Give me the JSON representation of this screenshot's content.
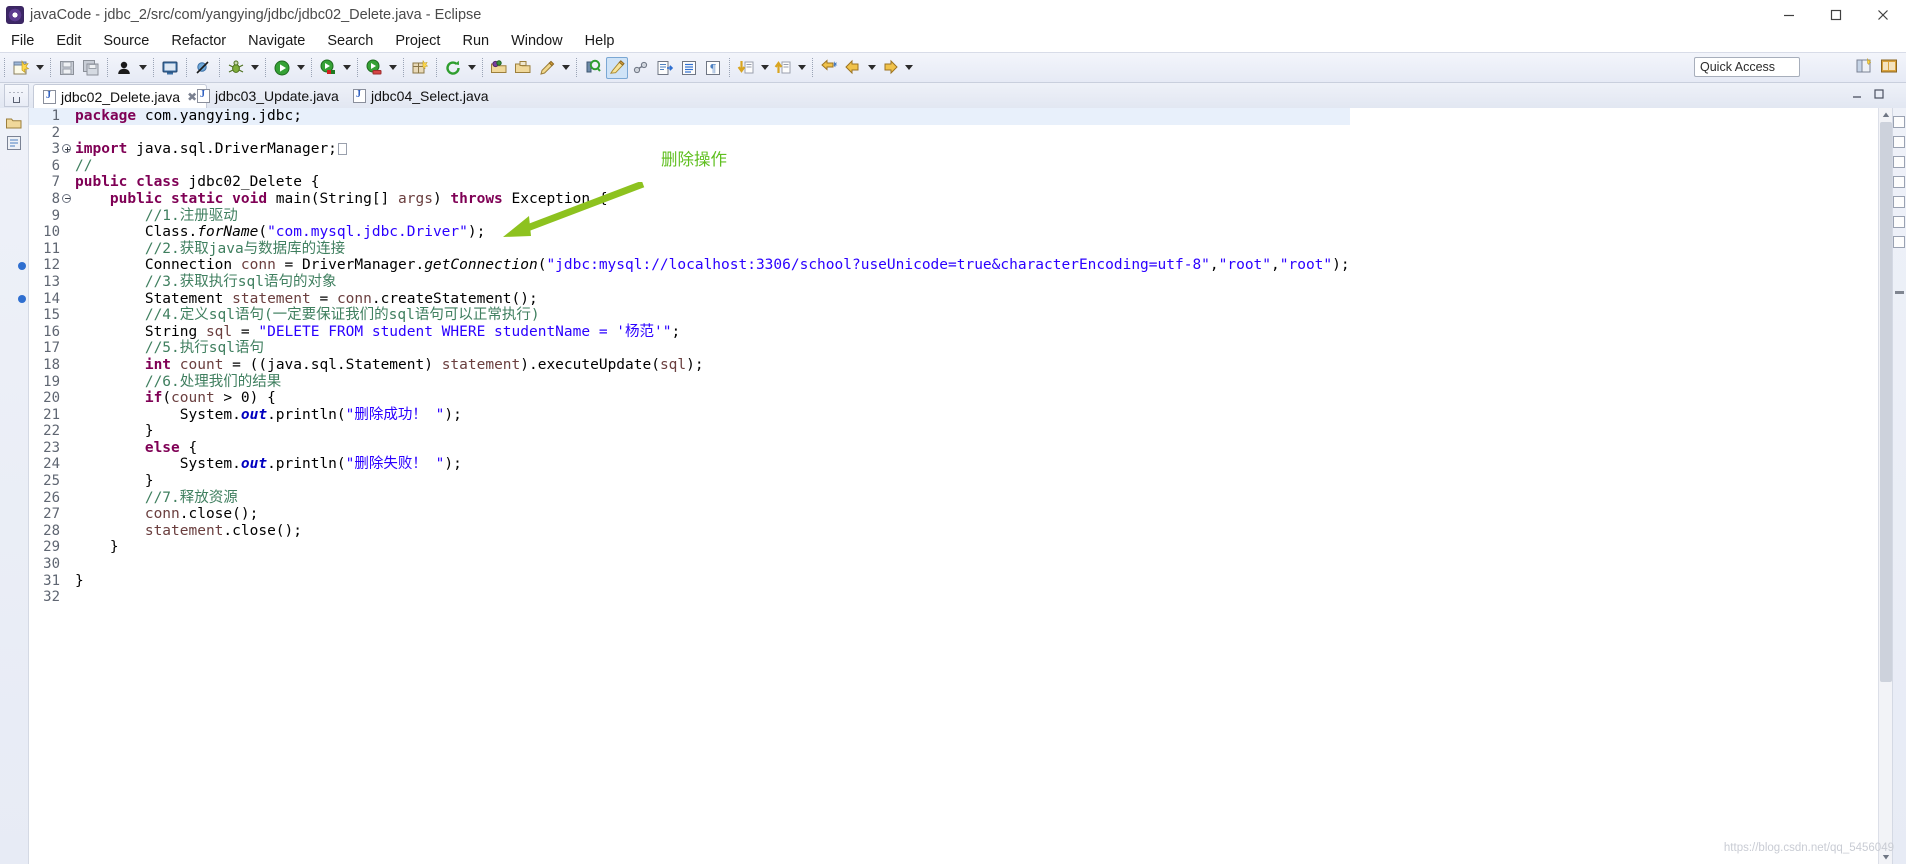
{
  "window": {
    "title": "javaCode - jdbc_2/src/com/yangying/jdbc/jdbc02_Delete.java - Eclipse",
    "app_icon": "eclipse-icon",
    "minimize": "minimize-button",
    "maximize": "maximize-button",
    "close": "close-button"
  },
  "menubar": {
    "items": [
      {
        "label": "File"
      },
      {
        "label": "Edit"
      },
      {
        "label": "Source"
      },
      {
        "label": "Refactor"
      },
      {
        "label": "Navigate"
      },
      {
        "label": "Search"
      },
      {
        "label": "Project"
      },
      {
        "label": "Run"
      },
      {
        "label": "Window"
      },
      {
        "label": "Help"
      }
    ]
  },
  "toolbar": {
    "quick_access": "Quick Access",
    "buttons": [
      "new-wizard-icon",
      "save-icon",
      "save-all-icon",
      "person-icon",
      "console-icon",
      "skip-breakpoints-icon",
      "debug-icon",
      "run-icon",
      "coverage-icon",
      "external-tools-icon",
      "new-java-package-icon",
      "refresh-icon",
      "open-type-icon",
      "open-task-icon",
      "annotate-icon",
      "search-icon",
      "highlight-icon",
      "link-icon",
      "next-edit-icon",
      "toggle-block-icon",
      "pilcrow-icon",
      "next-annotation-icon",
      "previous-annotation-icon",
      "last-edit-icon",
      "back-icon",
      "forward-icon"
    ]
  },
  "tabs": [
    {
      "label": "jdbc02_Delete.java",
      "selected": true,
      "icon": "java-file-icon",
      "close": "close-tab-icon"
    },
    {
      "label": "jdbc03_Update.java",
      "selected": false,
      "icon": "java-file-icon"
    },
    {
      "label": "jdbc04_Select.java",
      "selected": false,
      "icon": "java-file-icon"
    }
  ],
  "editor": {
    "highlighted_line": 1,
    "breakpoint_lines": [
      12,
      14
    ],
    "lines": [
      {
        "num": "1",
        "marker": "",
        "indent": 0,
        "tokens": [
          {
            "t": "package",
            "c": "kw"
          },
          {
            "t": " com.yangying.jdbc;",
            "c": "plain"
          }
        ]
      },
      {
        "num": "2",
        "marker": "",
        "indent": 0,
        "tokens": []
      },
      {
        "num": "3",
        "marker": "fold-plus",
        "indent": 0,
        "tokens": [
          {
            "t": "import",
            "c": "kw"
          },
          {
            "t": " java.sql.DriverManager;",
            "c": "plain"
          },
          {
            "t": "□",
            "c": "fold-box"
          }
        ]
      },
      {
        "num": "6",
        "marker": "",
        "indent": 0,
        "tokens": [
          {
            "t": "//",
            "c": "cmt"
          }
        ]
      },
      {
        "num": "7",
        "marker": "",
        "indent": 0,
        "tokens": [
          {
            "t": "public class",
            "c": "kw"
          },
          {
            "t": " jdbc02_Delete {",
            "c": "plain"
          }
        ]
      },
      {
        "num": "8",
        "marker": "fold-minus",
        "indent": 1,
        "tokens": [
          {
            "t": "public static void",
            "c": "kw"
          },
          {
            "t": " main(String[] ",
            "c": "plain"
          },
          {
            "t": "args",
            "c": "par"
          },
          {
            "t": ") ",
            "c": "plain"
          },
          {
            "t": "throws",
            "c": "kw"
          },
          {
            "t": " Exception {",
            "c": "plain"
          }
        ]
      },
      {
        "num": "9",
        "marker": "",
        "indent": 2,
        "tokens": [
          {
            "t": "//1.注册驱动",
            "c": "cmt"
          }
        ]
      },
      {
        "num": "10",
        "marker": "",
        "indent": 2,
        "tokens": [
          {
            "t": "Class.",
            "c": "plain"
          },
          {
            "t": "forName",
            "c": "stat"
          },
          {
            "t": "(",
            "c": "plain"
          },
          {
            "t": "\"com.mysql.jdbc.Driver\"",
            "c": "str"
          },
          {
            "t": ");",
            "c": "plain"
          }
        ]
      },
      {
        "num": "11",
        "marker": "",
        "indent": 2,
        "tokens": [
          {
            "t": "//2.获取java与数据库的连接",
            "c": "cmt"
          }
        ]
      },
      {
        "num": "12",
        "marker": "bp",
        "indent": 2,
        "tokens": [
          {
            "t": "Connection ",
            "c": "plain"
          },
          {
            "t": "conn",
            "c": "par"
          },
          {
            "t": " = DriverManager.",
            "c": "plain"
          },
          {
            "t": "getConnection",
            "c": "stat"
          },
          {
            "t": "(",
            "c": "plain"
          },
          {
            "t": "\"jdbc:mysql://localhost:3306/school?useUnicode=true&characterEncoding=utf-8\"",
            "c": "str"
          },
          {
            "t": ",",
            "c": "plain"
          },
          {
            "t": "\"root\"",
            "c": "str"
          },
          {
            "t": ",",
            "c": "plain"
          },
          {
            "t": "\"root\"",
            "c": "str"
          },
          {
            "t": ");",
            "c": "plain"
          }
        ]
      },
      {
        "num": "13",
        "marker": "",
        "indent": 2,
        "tokens": [
          {
            "t": "//3.获取执行sql语句的对象",
            "c": "cmt"
          }
        ]
      },
      {
        "num": "14",
        "marker": "bp",
        "indent": 2,
        "tokens": [
          {
            "t": "Statement ",
            "c": "plain"
          },
          {
            "t": "statement",
            "c": "par"
          },
          {
            "t": " = ",
            "c": "plain"
          },
          {
            "t": "conn",
            "c": "par"
          },
          {
            "t": ".createStatement();",
            "c": "plain"
          }
        ]
      },
      {
        "num": "15",
        "marker": "",
        "indent": 2,
        "tokens": [
          {
            "t": "//4.定义sql语句(一定要保证我们的sql语句可以正常执行)",
            "c": "cmt"
          }
        ]
      },
      {
        "num": "16",
        "marker": "",
        "indent": 2,
        "tokens": [
          {
            "t": "String ",
            "c": "plain"
          },
          {
            "t": "sql",
            "c": "par"
          },
          {
            "t": " = ",
            "c": "plain"
          },
          {
            "t": "\"DELETE FROM student WHERE studentName = '杨范'\"",
            "c": "str"
          },
          {
            "t": ";",
            "c": "plain"
          }
        ]
      },
      {
        "num": "17",
        "marker": "",
        "indent": 2,
        "tokens": [
          {
            "t": "//5.执行sql语句",
            "c": "cmt"
          }
        ]
      },
      {
        "num": "18",
        "marker": "",
        "indent": 2,
        "tokens": [
          {
            "t": "int",
            "c": "kw"
          },
          {
            "t": " ",
            "c": "plain"
          },
          {
            "t": "count",
            "c": "par"
          },
          {
            "t": " = ((java.sql.Statement) ",
            "c": "plain"
          },
          {
            "t": "statement",
            "c": "par"
          },
          {
            "t": ").executeUpdate(",
            "c": "plain"
          },
          {
            "t": "sql",
            "c": "par"
          },
          {
            "t": ");",
            "c": "plain"
          }
        ]
      },
      {
        "num": "19",
        "marker": "",
        "indent": 2,
        "tokens": [
          {
            "t": "//6.处理我们的结果",
            "c": "cmt"
          }
        ]
      },
      {
        "num": "20",
        "marker": "",
        "indent": 2,
        "tokens": [
          {
            "t": "if",
            "c": "kw"
          },
          {
            "t": "(",
            "c": "plain"
          },
          {
            "t": "count",
            "c": "par"
          },
          {
            "t": " > 0) {",
            "c": "plain"
          }
        ]
      },
      {
        "num": "21",
        "marker": "",
        "indent": 3,
        "tokens": [
          {
            "t": "System.",
            "c": "plain"
          },
          {
            "t": "out",
            "c": "sf"
          },
          {
            "t": ".println(",
            "c": "plain"
          },
          {
            "t": "\"删除成功！ \"",
            "c": "str"
          },
          {
            "t": ");",
            "c": "plain"
          }
        ]
      },
      {
        "num": "22",
        "marker": "",
        "indent": 2,
        "tokens": [
          {
            "t": "}",
            "c": "plain"
          }
        ]
      },
      {
        "num": "23",
        "marker": "",
        "indent": 2,
        "tokens": [
          {
            "t": "else",
            "c": "kw"
          },
          {
            "t": " {",
            "c": "plain"
          }
        ]
      },
      {
        "num": "24",
        "marker": "",
        "indent": 3,
        "tokens": [
          {
            "t": "System.",
            "c": "plain"
          },
          {
            "t": "out",
            "c": "sf"
          },
          {
            "t": ".println(",
            "c": "plain"
          },
          {
            "t": "\"删除失败！ \"",
            "c": "str"
          },
          {
            "t": ");",
            "c": "plain"
          }
        ]
      },
      {
        "num": "25",
        "marker": "",
        "indent": 2,
        "tokens": [
          {
            "t": "}",
            "c": "plain"
          }
        ]
      },
      {
        "num": "26",
        "marker": "",
        "indent": 2,
        "tokens": [
          {
            "t": "//7.释放资源",
            "c": "cmt"
          }
        ]
      },
      {
        "num": "27",
        "marker": "",
        "indent": 2,
        "tokens": [
          {
            "t": "conn",
            "c": "par"
          },
          {
            "t": ".close();",
            "c": "plain"
          }
        ]
      },
      {
        "num": "28",
        "marker": "",
        "indent": 2,
        "tokens": [
          {
            "t": "statement",
            "c": "par"
          },
          {
            "t": ".close();",
            "c": "plain"
          }
        ]
      },
      {
        "num": "29",
        "marker": "",
        "indent": 1,
        "tokens": [
          {
            "t": "}",
            "c": "plain"
          }
        ]
      },
      {
        "num": "30",
        "marker": "",
        "indent": 0,
        "tokens": []
      },
      {
        "num": "31",
        "marker": "",
        "indent": 0,
        "tokens": [
          {
            "t": "}",
            "c": "plain"
          }
        ]
      },
      {
        "num": "32",
        "marker": "",
        "indent": 0,
        "tokens": []
      }
    ]
  },
  "annotation": {
    "text": "删除操作",
    "color": "#6fbf20",
    "arrow": "green-arrow-pointing-left-down"
  },
  "watermark": {
    "text": "https://blog.csdn.net/qq_5456049"
  },
  "colors": {
    "keyword": "#7f0055",
    "string": "#2a00ff",
    "comment": "#3f7f5f",
    "parameter": "#6a3e3e",
    "static_field": "#0000c0",
    "accent": "#6fbf20",
    "line_highlight": "#e8f0fb"
  }
}
